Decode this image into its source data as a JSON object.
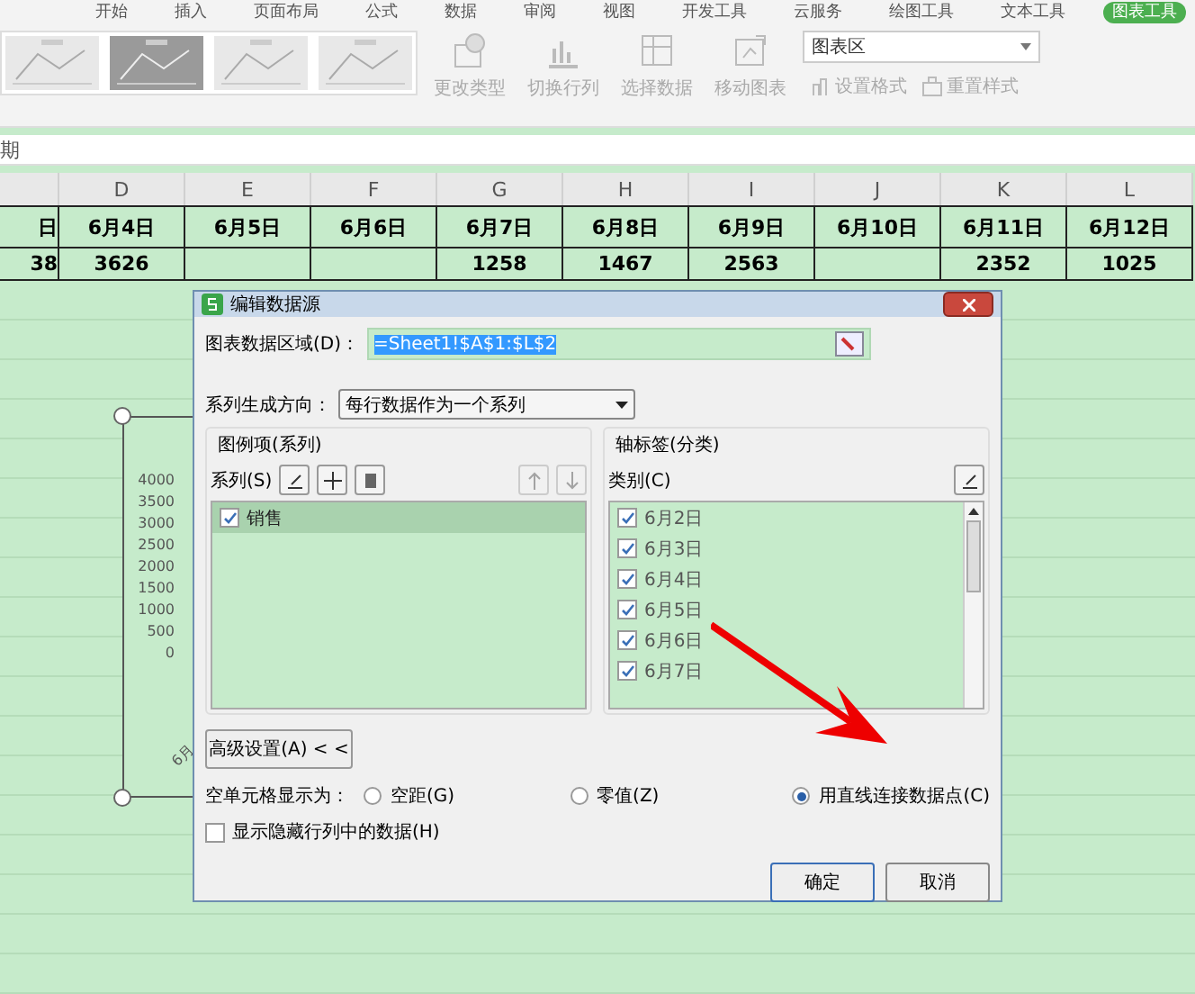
{
  "ribbon_tabs": [
    {
      "label": "开始",
      "selected": false
    },
    {
      "label": "插入",
      "selected": false
    },
    {
      "label": "页面布局",
      "selected": false
    },
    {
      "label": "公式",
      "selected": false
    },
    {
      "label": "数据",
      "selected": false
    },
    {
      "label": "审阅",
      "selected": false
    },
    {
      "label": "视图",
      "selected": false
    },
    {
      "label": "开发工具",
      "selected": false
    },
    {
      "label": "云服务",
      "selected": false
    },
    {
      "label": "绘图工具",
      "selected": false
    },
    {
      "label": "文本工具",
      "selected": false
    },
    {
      "label": "图表工具",
      "selected": true
    }
  ],
  "ribbon": {
    "style_thumbnails": [
      {
        "kind": "picture",
        "selected": false
      },
      {
        "kind": "picture",
        "selected": true
      },
      {
        "kind": "picture",
        "selected": false
      },
      {
        "kind": "picture",
        "selected": false
      }
    ],
    "buttons": [
      {
        "label": "更改类型",
        "kind": "chart"
      },
      {
        "label": "切换行列",
        "kind": "switch"
      },
      {
        "label": "选择数据",
        "kind": "select"
      },
      {
        "label": "移动图表",
        "kind": "move"
      }
    ],
    "element_select": {
      "value": "图表区"
    },
    "small_buttons": [
      {
        "label": "设置格式",
        "kind": "format"
      },
      {
        "label": "重置样式",
        "kind": "reset"
      }
    ]
  },
  "formula_bar": {
    "value": "期"
  },
  "sheet": {
    "columns": [
      "",
      "D",
      "E",
      "F",
      "G",
      "H",
      "I",
      "J",
      "K",
      "L"
    ],
    "rows": [
      [
        "日",
        "6月4日",
        "6月5日",
        "6月6日",
        "6月7日",
        "6月8日",
        "6月9日",
        "6月10日",
        "6月11日",
        "6月12日"
      ],
      [
        "38",
        "3626",
        "",
        "",
        "1258",
        "1467",
        "2563",
        "",
        "2352",
        "1025"
      ]
    ]
  },
  "chart": {
    "y_labels": [
      "4000",
      "3500",
      "3000",
      "2500",
      "2000",
      "1500",
      "1000",
      "500",
      "0"
    ],
    "x_label": "6月"
  },
  "dialog": {
    "title": "编辑数据源",
    "range": {
      "label": "图表数据区域(D)：",
      "value": "=Sheet1!$A$1:$L$2"
    },
    "direction": {
      "label": "系列生成方向：",
      "value": "每行数据作为一个系列"
    },
    "series_group": {
      "title": "图例项(系列)",
      "label": "系列(S)",
      "items": [
        {
          "label": "销售",
          "checked": true,
          "selected": true
        }
      ]
    },
    "category_group": {
      "title": "轴标签(分类)",
      "label": "类别(C)",
      "items": [
        {
          "label": "6月2日",
          "checked": true
        },
        {
          "label": "6月3日",
          "checked": true
        },
        {
          "label": "6月4日",
          "checked": true
        },
        {
          "label": "6月5日",
          "checked": true
        },
        {
          "label": "6月6日",
          "checked": true
        },
        {
          "label": "6月7日",
          "checked": true
        }
      ]
    },
    "advanced_button": "高级设置(A)  < <",
    "empty_cells": {
      "label": "空单元格显示为：",
      "options": [
        {
          "label": "空距(G)",
          "selected": false
        },
        {
          "label": "零值(Z)",
          "selected": false
        },
        {
          "label": "用直线连接数据点(C)",
          "selected": true
        }
      ]
    },
    "show_hidden": {
      "label": "显示隐藏行列中的数据(H)",
      "checked": false
    },
    "buttons": [
      {
        "label": "确定",
        "kind": "ok"
      },
      {
        "label": "取消",
        "kind": "cancel"
      }
    ]
  }
}
